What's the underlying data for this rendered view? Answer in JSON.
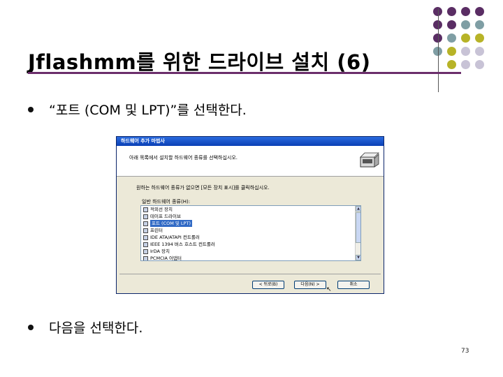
{
  "slide": {
    "title": "Jflashmm를 위한 드라이브 설치 (6)",
    "bullets": [
      "“포트 (COM 및 LPT)”를 선택한다.",
      "다음을 선택한다."
    ],
    "page_number": "73",
    "accent_colors": {
      "purple": "#5a2d64",
      "teal": "#7f9ea4",
      "olive": "#b7b327",
      "lavender": "#c8c3d6"
    }
  },
  "dialog": {
    "title": "하드웨어 추가 마법사",
    "header_text": "아래 목록에서 설치할 하드웨어 종류를 선택하십시오.",
    "instruction": "원하는 하드웨어 종류가 없으면 [모든 장치 표시]를 클릭하십시오.",
    "list_label": "일반 하드웨어 종류(H):",
    "items": [
      {
        "label": "적외선 장치",
        "icon": "infrared-icon"
      },
      {
        "label": "테이프 드라이브",
        "icon": "tape-drive-icon"
      },
      {
        "label": "포트 (COM 및 LPT)",
        "icon": "port-icon"
      },
      {
        "label": "프린터",
        "icon": "printer-icon"
      },
      {
        "label": "IDE ATA/ATAPI 컨트롤러",
        "icon": "ide-controller-icon"
      },
      {
        "label": "IEEE 1394 버스 호스트 컨트롤러",
        "icon": "ieee1394-icon"
      },
      {
        "label": "IrDA 장치",
        "icon": "irda-icon"
      },
      {
        "label": "PCMCIA 어댑터",
        "icon": "pcmcia-icon"
      }
    ],
    "selected_index": 2,
    "buttons": {
      "back": "< 뒤로(B)",
      "next": "다음(N) >",
      "cancel": "취소"
    }
  }
}
